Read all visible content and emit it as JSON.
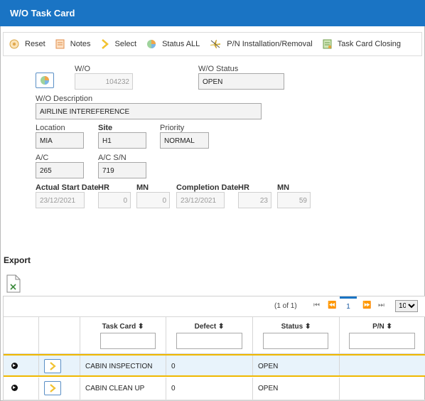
{
  "window": {
    "title": "W/O Task Card"
  },
  "toolbar": {
    "items": [
      {
        "label": "Reset",
        "icon": "reset-icon"
      },
      {
        "label": "Notes",
        "icon": "notes-icon"
      },
      {
        "label": "Select",
        "icon": "select-chevron-icon"
      },
      {
        "label": "Status ALL",
        "icon": "pie-chart-icon"
      },
      {
        "label": "P/N Installation/Removal",
        "icon": "aircraft-icon"
      },
      {
        "label": "Task Card Closing",
        "icon": "closing-icon"
      }
    ]
  },
  "form": {
    "wo_label": "W/O",
    "wo_value": "104232",
    "wo_status_label": "W/O Status",
    "wo_status_value": "OPEN",
    "wo_description_label": "W/O Description",
    "wo_description_value": "AIRLINE INTEREFERENCE",
    "location_label": "Location",
    "location_value": "MIA",
    "site_label": "Site",
    "site_value": "H1",
    "priority_label": "Priority",
    "priority_value": "NORMAL",
    "ac_label": "A/C",
    "ac_value": "265",
    "ac_sn_label": "A/C S/N",
    "ac_sn_value": "719",
    "actual_start_date_label": "Actual Start Date",
    "actual_start_date_value": "23/12/2021",
    "start_hr_label": "HR",
    "start_hr_value": "0",
    "start_mn_label": "MN",
    "start_mn_value": "0",
    "completion_date_label": "Completion Date",
    "completion_date_value": "23/12/2021",
    "completion_hr_label": "HR",
    "completion_hr_value": "23",
    "completion_mn_label": "MN",
    "completion_mn_value": "59"
  },
  "export": {
    "label": "Export",
    "icon": "excel-export-icon"
  },
  "grid": {
    "pager": {
      "info": "(1 of 1)",
      "current_page": "1",
      "page_size": "10",
      "page_size_options": [
        "10"
      ]
    },
    "columns": [
      "Task Card",
      "Defect",
      "Status",
      "P/N"
    ],
    "rows": [
      {
        "task_card": "CABIN INSPECTION",
        "defect": "0",
        "status": "OPEN",
        "pn": ""
      },
      {
        "task_card": "CABIN CLEAN UP",
        "defect": "0",
        "status": "OPEN",
        "pn": ""
      }
    ]
  },
  "colors": {
    "header_blue": "#1a74c4",
    "selected_row_border": "#f0b800",
    "selected_row_bg": "#e8f3fb"
  }
}
